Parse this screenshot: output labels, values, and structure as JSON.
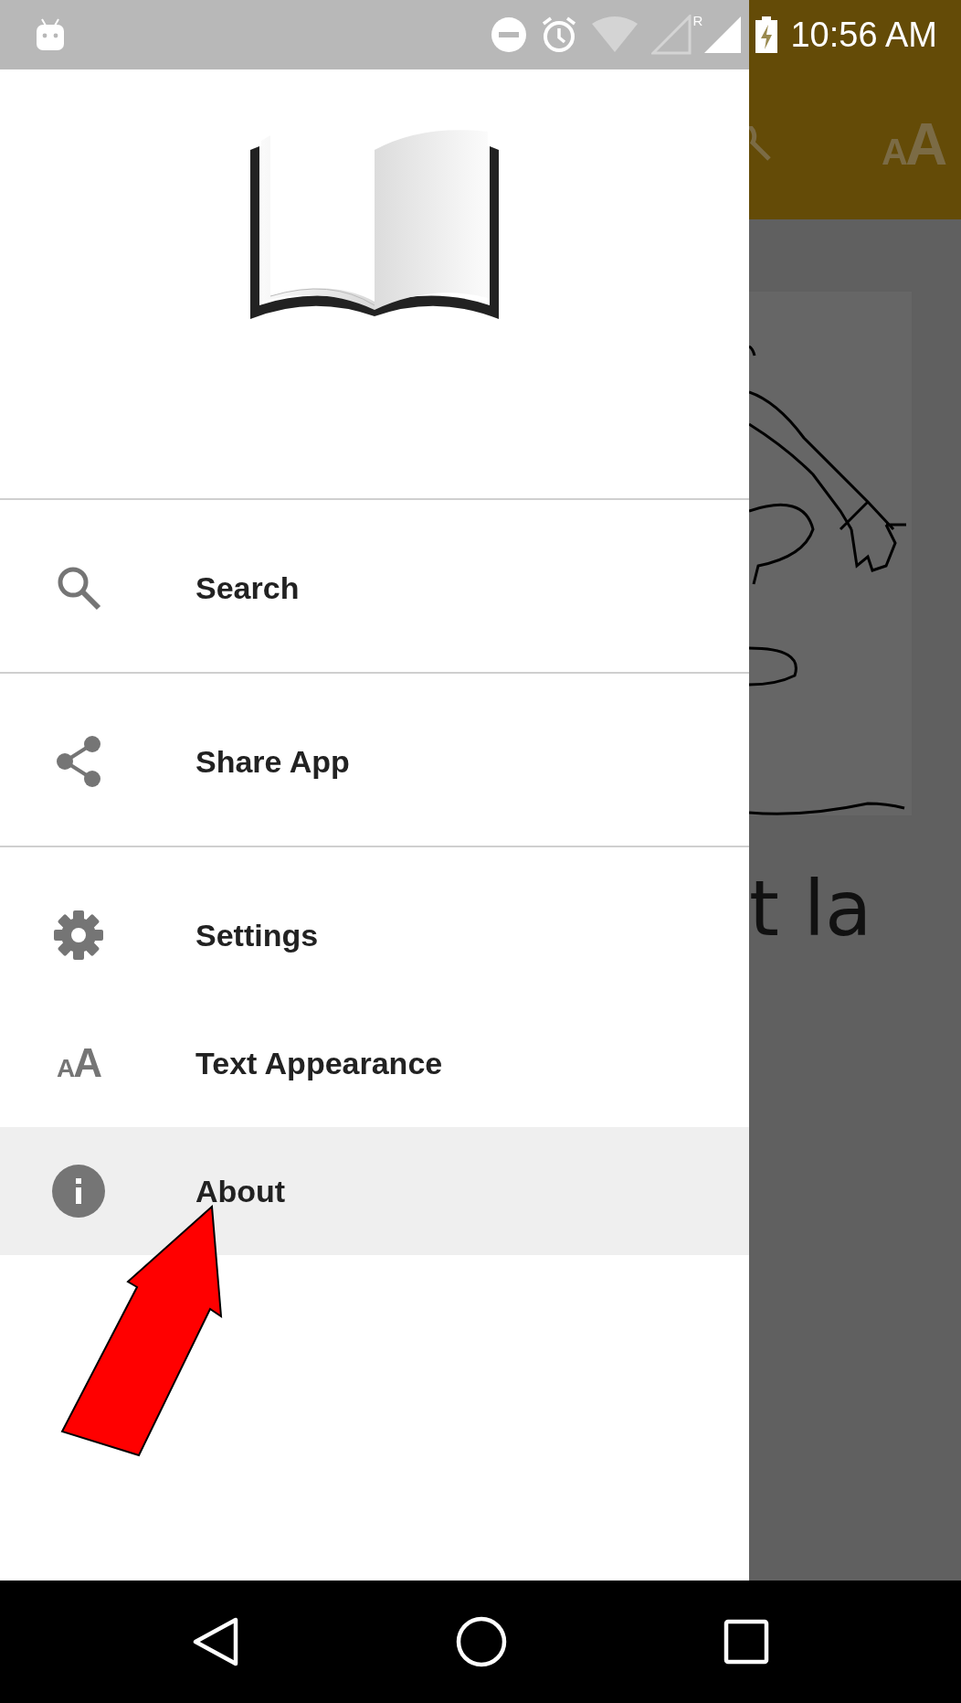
{
  "status_bar": {
    "roaming_mark": "R",
    "time": "10:56 AM"
  },
  "app_bar": {
    "text_size_icon": "AA"
  },
  "content": {
    "text": "t la"
  },
  "drawer": {
    "sections": [
      {
        "items": [
          {
            "kind": "search",
            "label": "Search",
            "selected": false
          }
        ]
      },
      {
        "items": [
          {
            "kind": "share",
            "label": "Share App",
            "selected": false
          }
        ]
      },
      {
        "items": [
          {
            "kind": "settings",
            "label": "Settings",
            "selected": false
          },
          {
            "kind": "text",
            "label": "Text Appearance",
            "selected": false,
            "glyph": "AA"
          },
          {
            "kind": "info",
            "label": "About",
            "selected": true
          }
        ]
      }
    ]
  }
}
